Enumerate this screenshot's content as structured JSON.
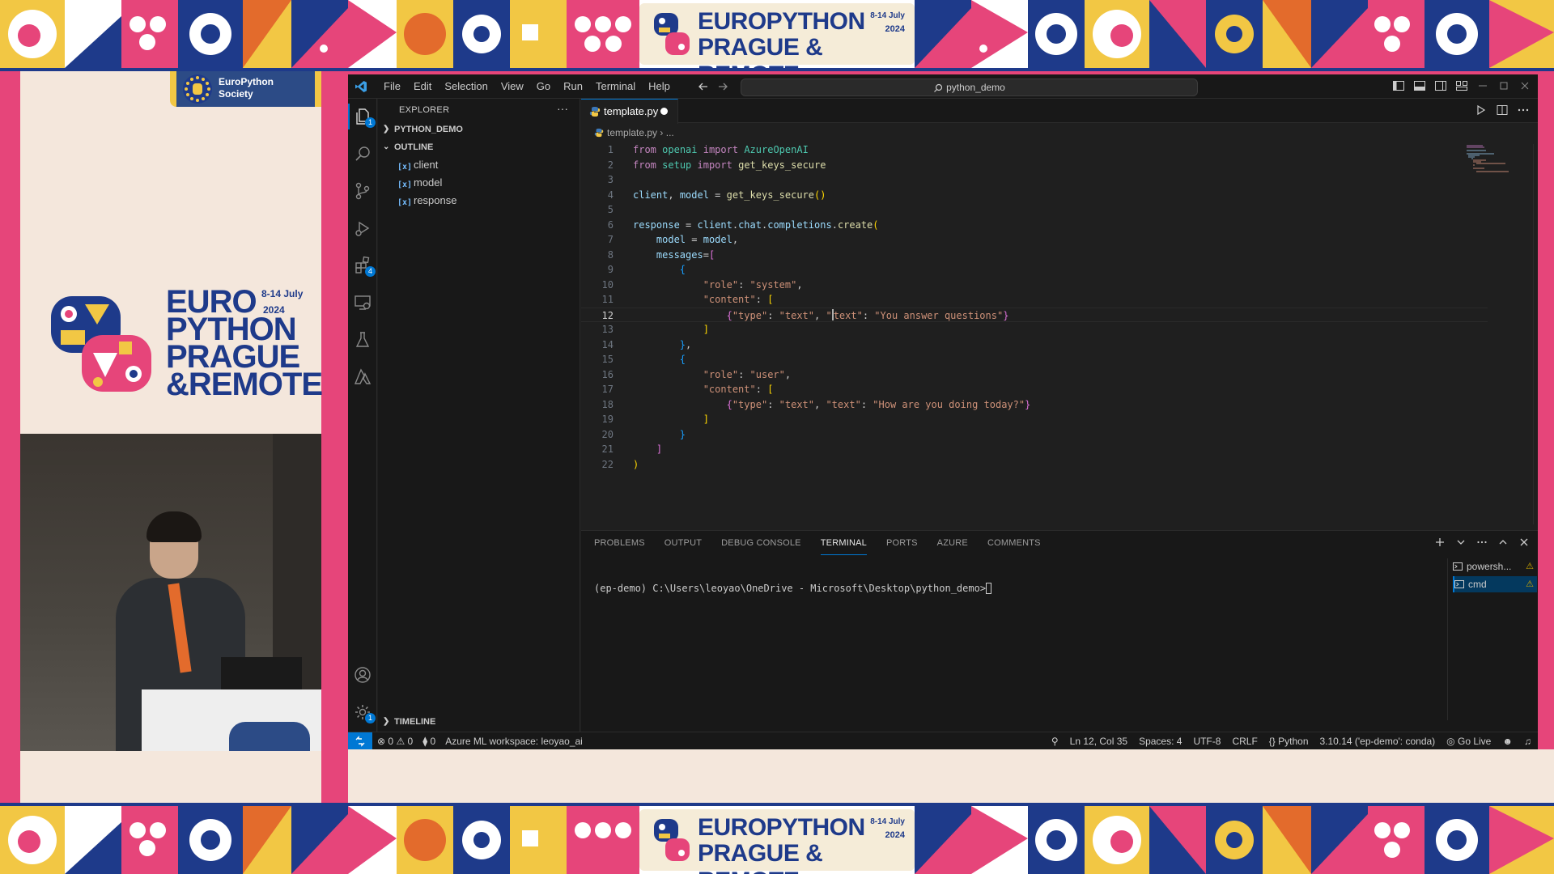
{
  "banner": {
    "line1": "EUROPYTHON",
    "line2": "PRAGUE & REMOTE",
    "dates": "8-14 July",
    "year": "2024"
  },
  "left_panel": {
    "society_label": "EuroPython Society",
    "logo_dates": "8-14 July",
    "logo_year": "2024",
    "logo_lines": [
      "EURO",
      "PYTHON",
      "PRAGUE",
      "&REMOTE"
    ]
  },
  "titlebar": {
    "menu": [
      "File",
      "Edit",
      "Selection",
      "View",
      "Go",
      "Run",
      "Terminal",
      "Help"
    ],
    "command_center": "python_demo"
  },
  "activity_bar": {
    "explorer_badge": "1",
    "extensions_badge": "4",
    "settings_badge": "1"
  },
  "sidebar": {
    "title": "EXPLORER",
    "more": "···",
    "folder": "PYTHON_DEMO",
    "outline_header": "OUTLINE",
    "outline_items": [
      "client",
      "model",
      "response"
    ],
    "timeline_header": "TIMELINE"
  },
  "editor": {
    "tab_label": "template.py",
    "breadcrumb_file": "template.py",
    "breadcrumb_rest": "...",
    "line_numbers": [
      "1",
      "2",
      "3",
      "4",
      "5",
      "6",
      "7",
      "8",
      "9",
      "10",
      "11",
      "12",
      "13",
      "14",
      "15",
      "16",
      "17",
      "18",
      "19",
      "20",
      "21",
      "22"
    ],
    "current_line": 12
  },
  "panel": {
    "tabs": [
      "PROBLEMS",
      "OUTPUT",
      "DEBUG CONSOLE",
      "TERMINAL",
      "PORTS",
      "AZURE",
      "COMMENTS"
    ],
    "active_tab": "TERMINAL",
    "prompt": "(ep-demo) C:\\Users\\leoyao\\OneDrive - Microsoft\\Desktop\\python_demo>",
    "terminals": [
      "powersh...",
      "cmd"
    ]
  },
  "statusbar": {
    "errors": "0",
    "warnings": "0",
    "ports": "0",
    "workspace": "Azure ML workspace: leoyao_ai",
    "position": "Ln 12, Col 35",
    "spaces": "Spaces: 4",
    "encoding": "UTF-8",
    "eol": "CRLF",
    "language": "Python",
    "interpreter": "3.10.14 ('ep-demo': conda)",
    "golive": "Go Live"
  },
  "colors": {
    "accent": "#0078d4",
    "brand_blue": "#1e3a8a",
    "brand_pink": "#e6457a"
  }
}
